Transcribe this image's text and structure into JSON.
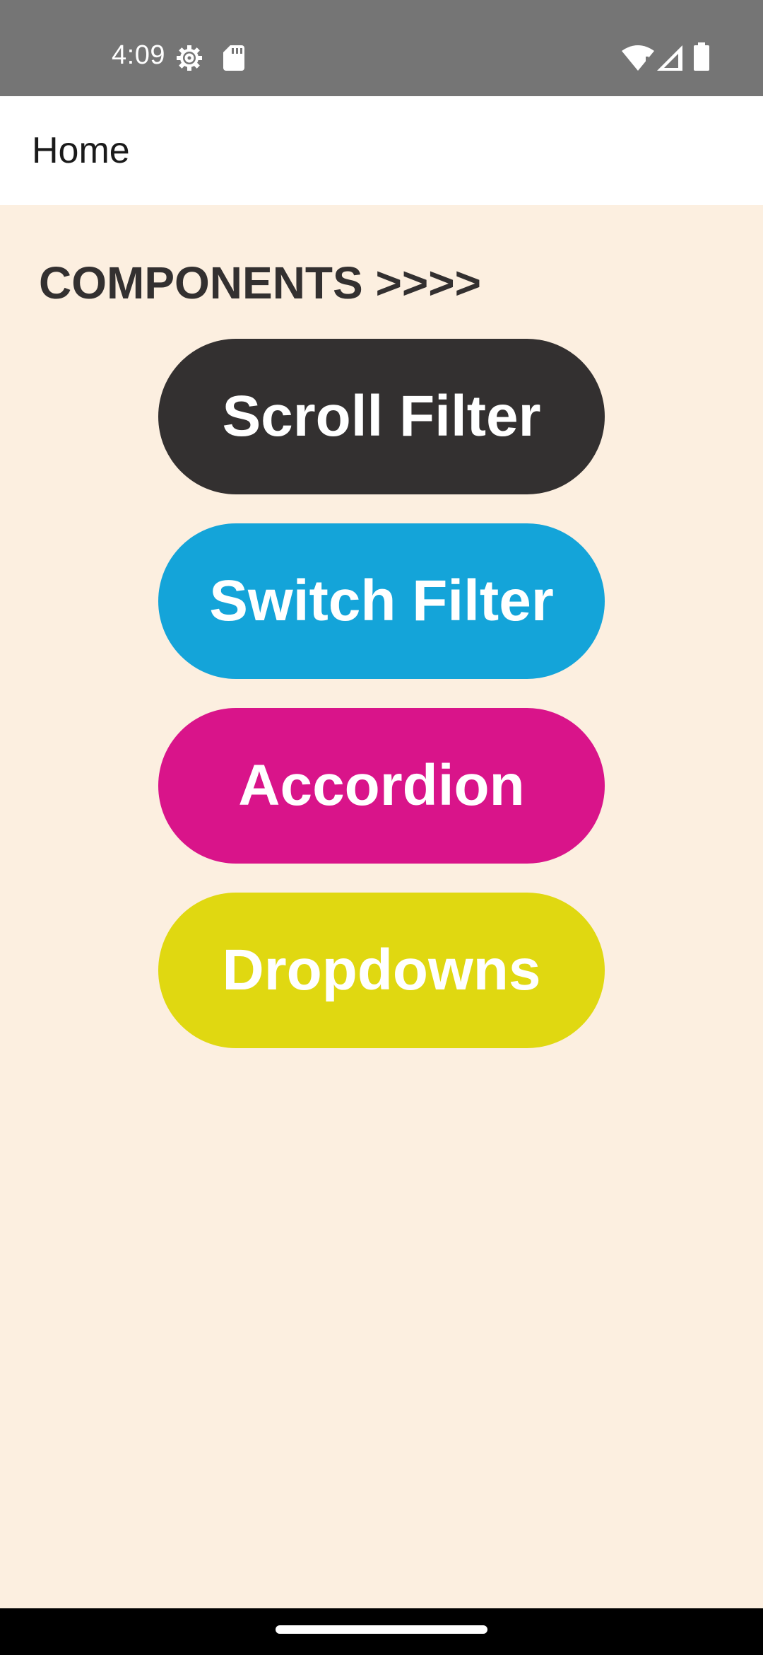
{
  "status_bar": {
    "time": "4:09",
    "icons": [
      "settings-gear-icon",
      "sd-card-icon",
      "wifi-icon",
      "cell-signal-icon",
      "battery-icon"
    ]
  },
  "app_bar": {
    "title": "Home"
  },
  "main": {
    "heading": "COMPONENTS >>>>",
    "buttons": [
      {
        "label": "Scroll Filter",
        "color": "#333030"
      },
      {
        "label": "Switch Filter",
        "color": "#14a4d9"
      },
      {
        "label": "Accordion",
        "color": "#d9148a"
      },
      {
        "label": "Dropdowns",
        "color": "#e0d811"
      }
    ]
  },
  "colors": {
    "background": "#fcefe0",
    "status_bar": "#757575",
    "nav_bar": "#000000"
  }
}
